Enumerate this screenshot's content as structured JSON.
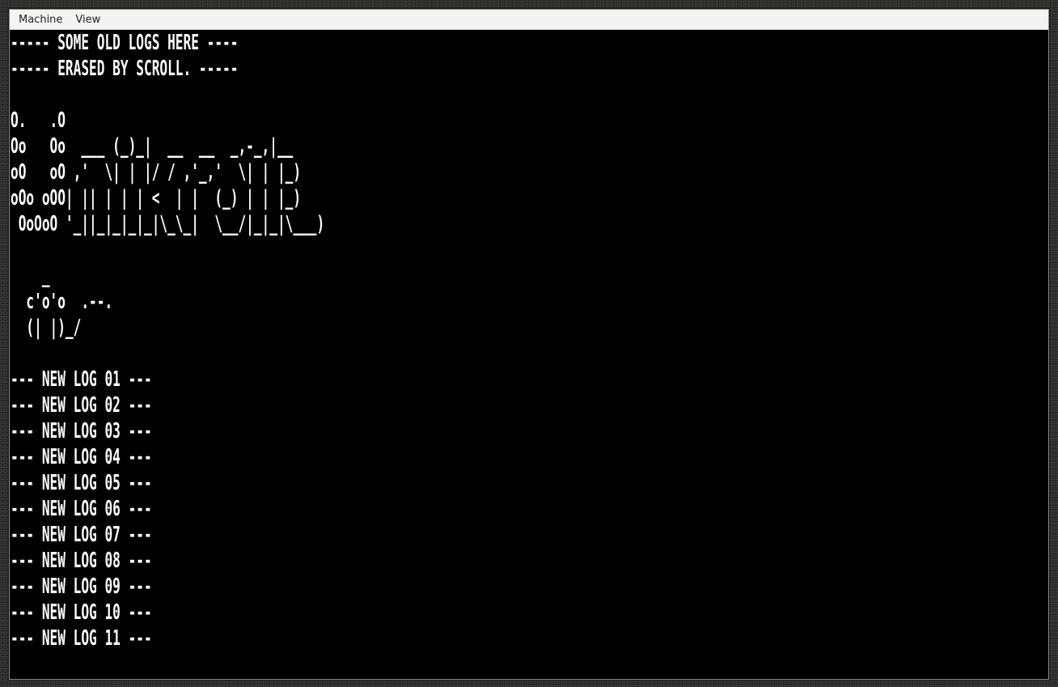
{
  "menubar": {
    "items": [
      "Machine",
      "View"
    ]
  },
  "terminal": {
    "lines": [
      "----- SOME OLD LOGS HERE ----",
      "----- ERASED BY SCROLL. -----",
      "",
      "O.   .O",
      "Oo   Oo  ___ (_)_|  __  __  _,-_,|__",
      "oO   oO ,'  \\| | |/ / ,'_,'  \\| | |_)",
      "oOo oOO| || | | | <  | |  (_) | | |_)",
      " OoOoO '_||_|_|_|_|\\_\\_|  \\__/|_|_|\\___)",
      "",
      "    _",
      "  c'o'o  .--.",
      "  (| |)_/",
      "",
      "--- NEW LOG 01 ---",
      "--- NEW LOG 02 ---",
      "--- NEW LOG 03 ---",
      "--- NEW LOG 04 ---",
      "--- NEW LOG 05 ---",
      "--- NEW LOG 06 ---",
      "--- NEW LOG 07 ---",
      "--- NEW LOG 08 ---",
      "--- NEW LOG 09 ---",
      "--- NEW LOG 10 ---",
      "--- NEW LOG 11 ---"
    ]
  },
  "colors": {
    "terminal_bg": "#000000",
    "terminal_fg": "#ffffff",
    "menubar_bg": "#f3f3f1",
    "desktop_bg": "#2c2c2c"
  }
}
